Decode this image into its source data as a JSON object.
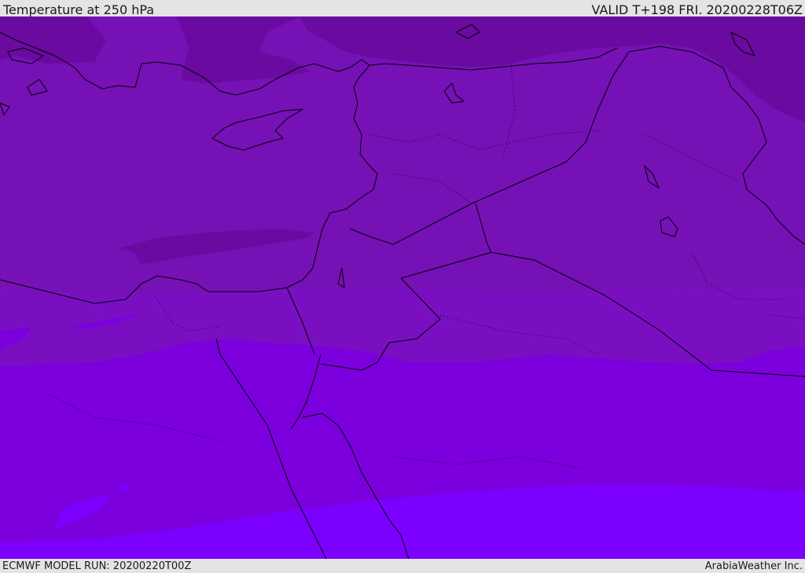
{
  "header": {
    "title": "Temperature at 250 hPa",
    "valid_time": "VALID T+198 FRI. 20200228T06Z"
  },
  "footer": {
    "model_run": "ECMWF MODEL RUN: 20200220T00Z",
    "credit": "ArabiaWeather Inc."
  },
  "colors": {
    "band_coldest": "#6a0aa0",
    "band_cold": "#7611b6",
    "band_mid": "#7a0fc2",
    "band_warm": "#7b00dd",
    "band_warmest": "#7c00ff",
    "coastline": "#000000"
  }
}
